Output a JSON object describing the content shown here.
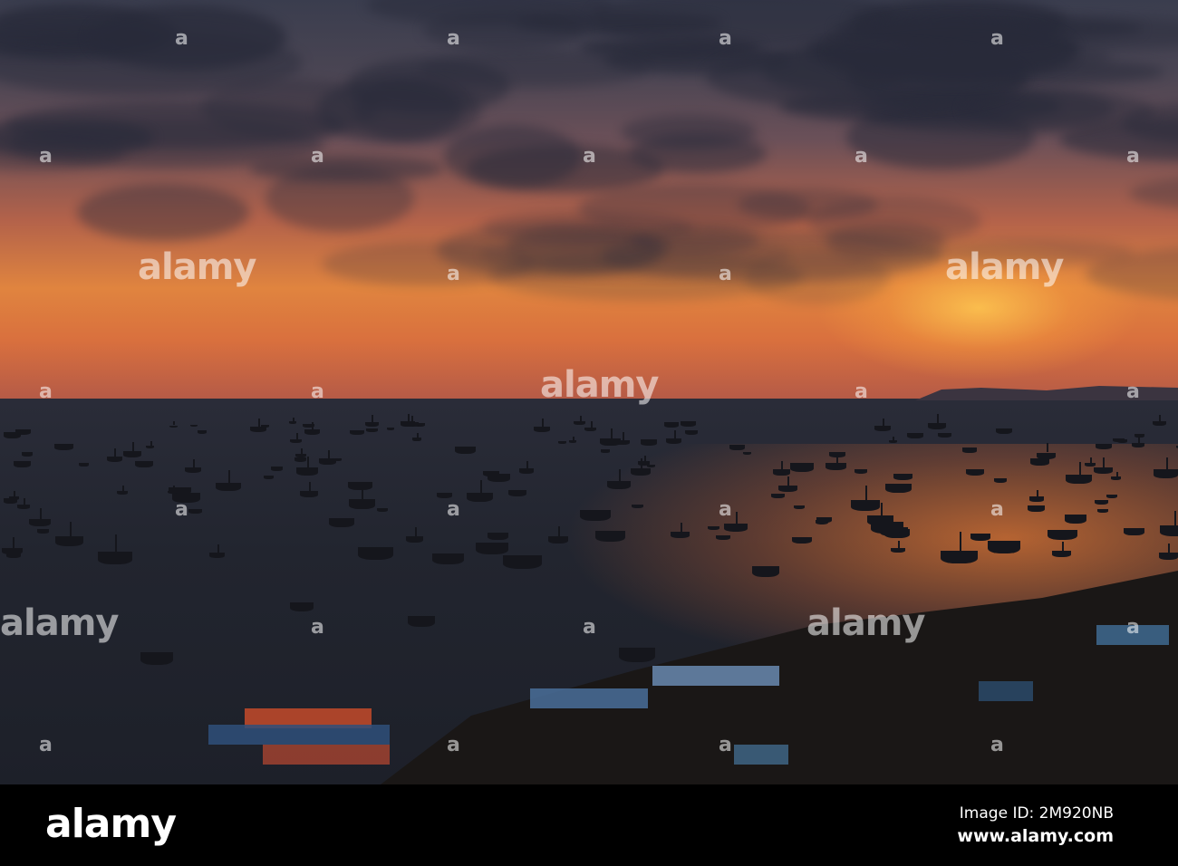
{
  "watermark": {
    "text": "alamy",
    "mark": "a"
  },
  "footer": {
    "logo": "alamy",
    "image_id": "Image ID: 2M920NB",
    "url": "www.alamy.com"
  },
  "colors": {
    "sky_top": "#3a3d4e",
    "horizon": "#e0843f",
    "sea": "#22252f",
    "footer": "#000000"
  }
}
